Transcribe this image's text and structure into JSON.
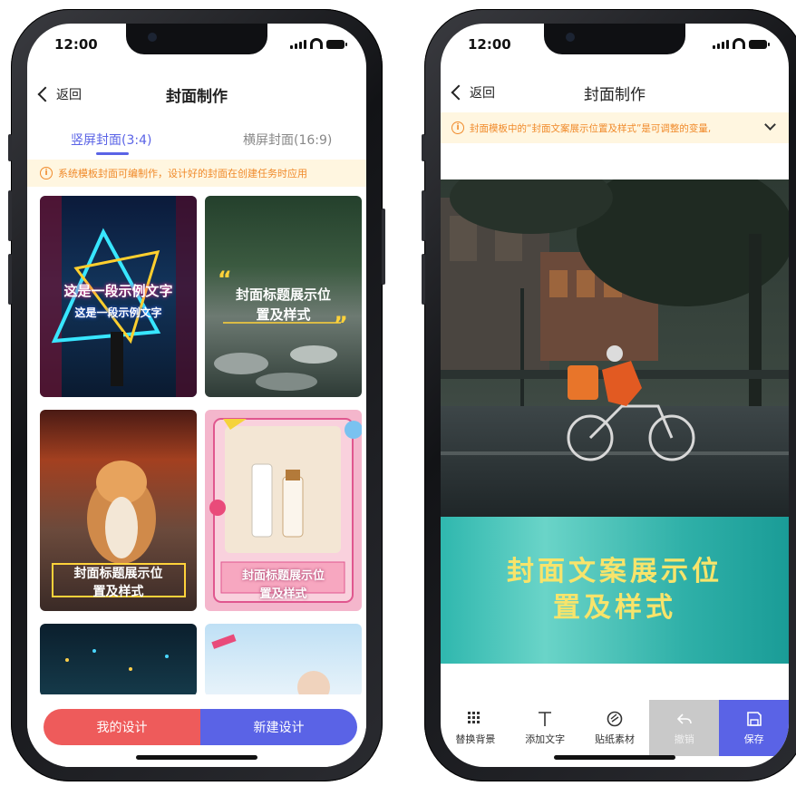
{
  "status": {
    "time": "12:00"
  },
  "left": {
    "nav": {
      "back_label": "返回",
      "title": "封面制作"
    },
    "tabs": [
      {
        "label": "竖屏封面(3:4)"
      },
      {
        "label": "横屏封面(16:9)"
      }
    ],
    "notice": "系统模板封面可编制作，设计好的封面在创建任务时应用",
    "templates": [
      {
        "caption_line1": "这是一段示例文字",
        "caption_line2": "这是一段示例文字"
      },
      {
        "caption_line1": "封面标题展示位",
        "caption_line2": "置及样式"
      },
      {
        "caption_line1": "封面标题展示位",
        "caption_line2": "置及样式"
      },
      {
        "caption_line1": "封面标题展示位",
        "caption_line2": "置及样式"
      }
    ],
    "buttons": {
      "my_designs": "我的设计",
      "new_design": "新建设计"
    }
  },
  "right": {
    "nav": {
      "back_label": "返回",
      "title": "封面制作"
    },
    "notice": "封面模板中的“封面文案展示位置及样式”是可调整的变量,",
    "banner": {
      "line1": "封面文案展示位",
      "line2": "置及样式"
    },
    "toolbar": [
      {
        "label": "替换背景",
        "icon": "grid-icon"
      },
      {
        "label": "添加文字",
        "icon": "text-icon"
      },
      {
        "label": "贴纸素材",
        "icon": "sticker-icon"
      },
      {
        "label": "撤销",
        "icon": "undo-icon"
      },
      {
        "label": "保存",
        "icon": "save-icon"
      }
    ]
  },
  "colors": {
    "accent": "#5a63e6",
    "danger": "#ee5b5b",
    "warning": "#f08a2a",
    "warning_bg": "#fff6e0",
    "banner_text": "#f7e46b"
  }
}
